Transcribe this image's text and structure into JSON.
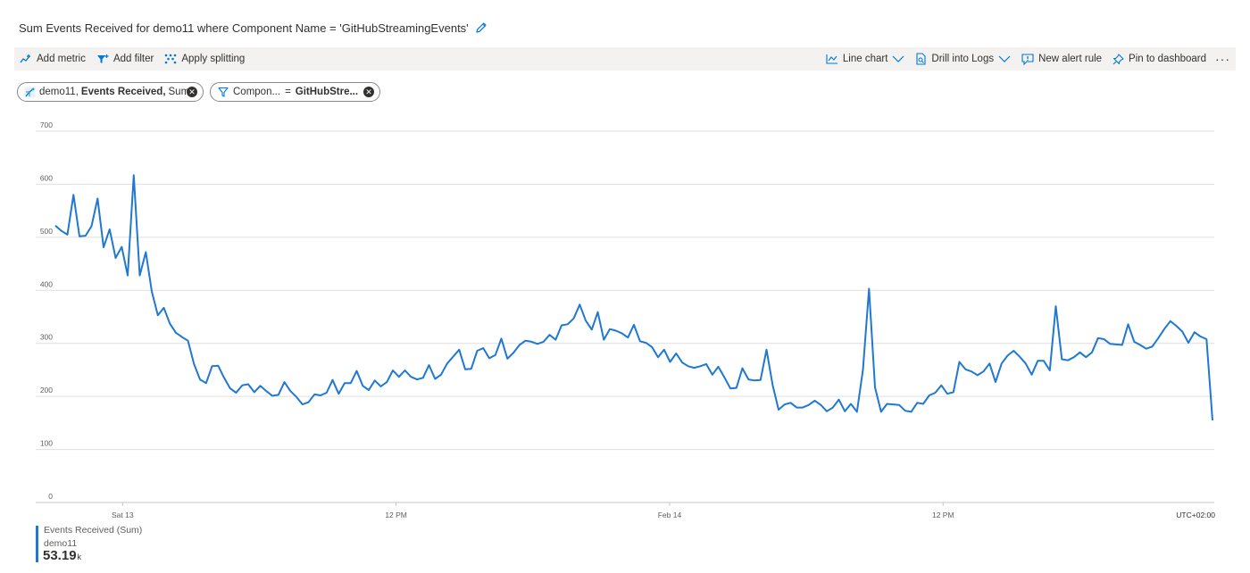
{
  "title": "Sum Events Received for demo11 where Component Name = 'GitHubStreamingEvents'",
  "toolbar": {
    "add_metric": "Add metric",
    "add_filter": "Add filter",
    "apply_splitting": "Apply splitting",
    "line_chart": "Line chart",
    "drill_into_logs": "Drill into Logs",
    "new_alert_rule": "New alert rule",
    "pin_to_dashboard": "Pin to dashboard",
    "more": "···"
  },
  "pills": {
    "metric": {
      "resource": "demo11,",
      "metric": "Events Received,",
      "aggregation": "Sum"
    },
    "filter": {
      "property": "Compon...",
      "operator": "=",
      "value": "GitHubStre..."
    }
  },
  "legend": {
    "series_label": "Events Received (Sum)",
    "resource": "demo11",
    "value": "53.19",
    "unit": "k",
    "color": "#1f78d1"
  },
  "timezone": "UTC+02:00",
  "chart_data": {
    "type": "line",
    "ylim": [
      0,
      700
    ],
    "yticks": [
      0,
      100,
      200,
      300,
      400,
      500,
      600,
      700
    ],
    "xlim": [
      0,
      1000
    ],
    "xticks": [
      {
        "label": "Sat 13",
        "x": 58
      },
      {
        "label": "12 PM",
        "x": 294
      },
      {
        "label": "Feb 14",
        "x": 530
      },
      {
        "label": "12 PM",
        "x": 766
      }
    ],
    "line_color": "#1f78d1",
    "grid": true,
    "series": [
      {
        "values": [
          522,
          512,
          505,
          580,
          502,
          503,
          521,
          573,
          481,
          515,
          461,
          482,
          428,
          617,
          428,
          472,
          398,
          353,
          367,
          337,
          320,
          312,
          305,
          261,
          232,
          225,
          257,
          258,
          235,
          215,
          207,
          221,
          223,
          208,
          220,
          210,
          201,
          203,
          227,
          210,
          199,
          185,
          189,
          204,
          202,
          207,
          231,
          205,
          225,
          225,
          248,
          220,
          212,
          230,
          219,
          227,
          249,
          237,
          249,
          237,
          232,
          235,
          259,
          233,
          241,
          262,
          275,
          288,
          251,
          252,
          286,
          291,
          272,
          278,
          309,
          271,
          282,
          297,
          305,
          303,
          299,
          303,
          316,
          307,
          334,
          336,
          347,
          373,
          343,
          326,
          359,
          307,
          327,
          324,
          319,
          311,
          335,
          304,
          301,
          293,
          274,
          288,
          265,
          281,
          264,
          257,
          254,
          257,
          261,
          241,
          256,
          236,
          215,
          216,
          253,
          232,
          230,
          231,
          288,
          222,
          175,
          185,
          188,
          179,
          179,
          184,
          192,
          184,
          172,
          179,
          194,
          172,
          186,
          171,
          250,
          403,
          217,
          171,
          186,
          185,
          184,
          173,
          171,
          188,
          186,
          202,
          207,
          221,
          205,
          208,
          265,
          251,
          247,
          240,
          247,
          262,
          227,
          262,
          277,
          286,
          275,
          262,
          241,
          267,
          267,
          249,
          370,
          270,
          268,
          274,
          283,
          274,
          283,
          310,
          308,
          299,
          298,
          297,
          336,
          303,
          297,
          290,
          294,
          310,
          327,
          342,
          333,
          322,
          301,
          321,
          313,
          308,
          155
        ]
      }
    ]
  }
}
